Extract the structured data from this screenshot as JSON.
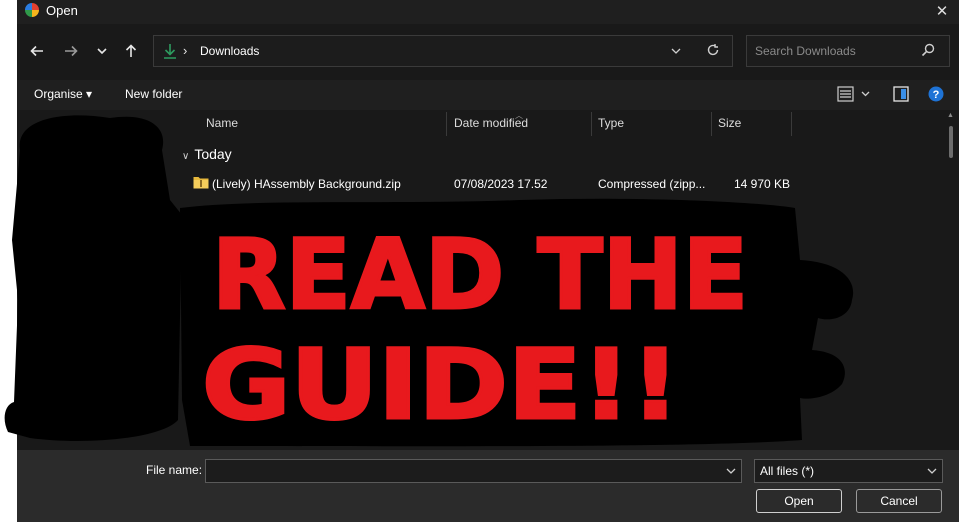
{
  "window": {
    "title": "Open",
    "close_label": "✕"
  },
  "navigation": {
    "back_icon": "arrow-left-icon",
    "forward_icon": "arrow-right-icon",
    "recent_icon": "chevron-down-icon",
    "up_icon": "arrow-up-icon",
    "address": {
      "icon": "download-icon",
      "separator": "›",
      "path": "Downloads"
    },
    "search": {
      "placeholder": "Search Downloads"
    }
  },
  "toolbar": {
    "organise_label": "Organise ▾",
    "new_folder_label": "New folder"
  },
  "columns": [
    "Name",
    "Date modified",
    "Type",
    "Size"
  ],
  "file_groups": [
    {
      "label": "Today",
      "files": [
        {
          "name": "(Lively) HAssembly Background.zip",
          "date": "07/08/2023 17.52",
          "type": "Compressed (zipp...",
          "size": "14 970 KB"
        }
      ]
    }
  ],
  "overlay": {
    "lines": [
      "READ THE",
      "GUIDE!!"
    ],
    "color": "#e8191d"
  },
  "footer": {
    "file_name_label": "File name:",
    "file_name_value": "",
    "filter_value": "All files (*)",
    "open_label": "Open",
    "cancel_label": "Cancel"
  },
  "colors": {
    "background": "#191919",
    "accent": "#2d9b5f",
    "help": "#1e73d6"
  }
}
